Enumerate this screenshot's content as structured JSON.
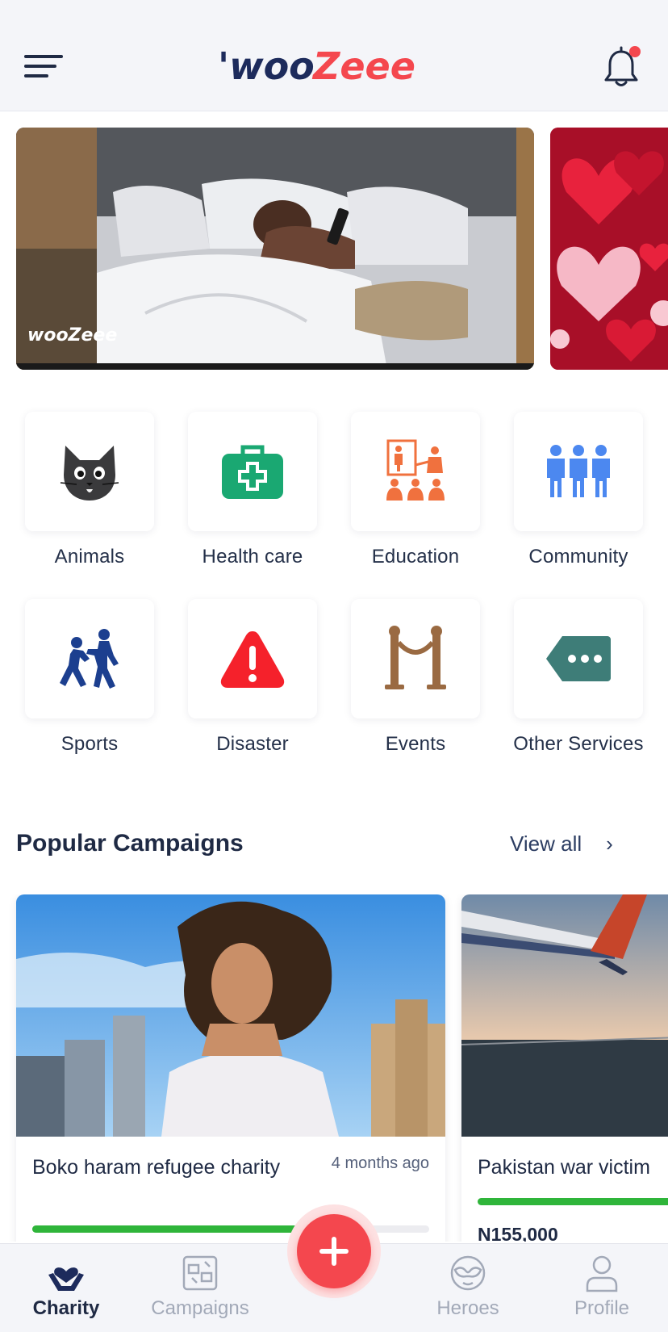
{
  "app": {
    "brand_name": "wooZeee"
  },
  "header": {
    "menu_icon": "hamburger-menu-icon",
    "bell_icon": "notification-bell-icon",
    "has_unread": true
  },
  "banners": [
    {
      "watermark": "wooZeee",
      "scene": "woman-in-bed-photo"
    },
    {
      "scene": "valentine-hearts-photo"
    }
  ],
  "categories": [
    {
      "label": "Animals",
      "icon": "cat-icon"
    },
    {
      "label": "Health care",
      "icon": "first-aid-kit-icon"
    },
    {
      "label": "Education",
      "icon": "classroom-icon"
    },
    {
      "label": "Community",
      "icon": "people-group-icon"
    },
    {
      "label": "Sports",
      "icon": "sports-players-icon"
    },
    {
      "label": "Disaster",
      "icon": "warning-icon"
    },
    {
      "label": "Events",
      "icon": "rope-barrier-icon"
    },
    {
      "label": "Other Services",
      "icon": "more-tag-icon"
    }
  ],
  "popular": {
    "title": "Popular Campaigns",
    "view_all": "View all",
    "campaigns": [
      {
        "title": "Boko haram refugee charity",
        "time": "4 months ago",
        "progress": 0.68
      },
      {
        "title": "Pakistan war victim",
        "amount": "N155,000",
        "progress": 1.0
      }
    ]
  },
  "bottom_nav": [
    {
      "label": "Charity",
      "icon": "hands-heart-icon",
      "active": true
    },
    {
      "label": "Campaigns",
      "icon": "campaigns-icon",
      "active": false
    },
    {
      "label": "Heroes",
      "icon": "hero-mask-icon",
      "active": false
    },
    {
      "label": "Profile",
      "icon": "profile-icon",
      "active": false
    }
  ],
  "fab": {
    "icon": "plus-icon"
  },
  "colors": {
    "accent": "#f4474e",
    "brand_navy": "#1d2b5c",
    "progress": "#2fb53a"
  }
}
